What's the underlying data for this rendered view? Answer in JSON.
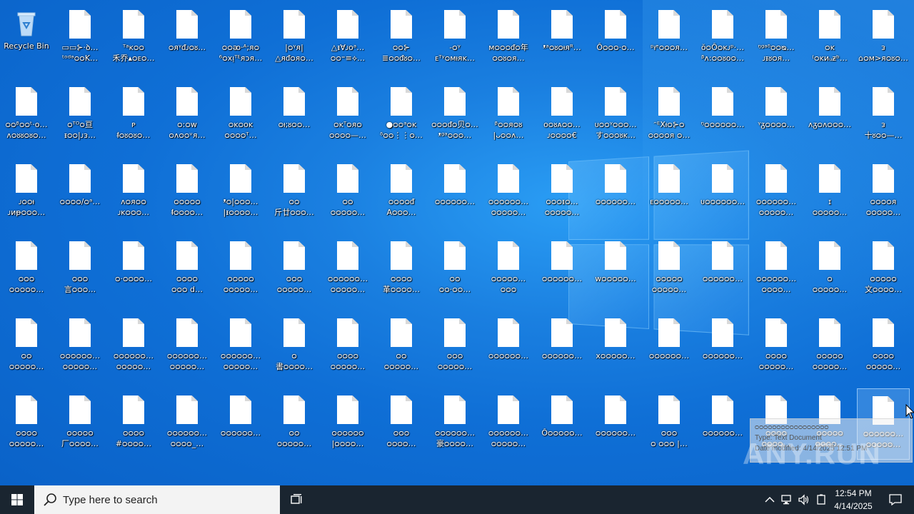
{
  "desktop": {
    "recycle_bin_label": "Recycle Bin",
    "icons": [
      [
        "▭▭⊱·ꝺ…\nᵗᵒᵈᵊᴑᴑK…",
        "ᵀᵃᴋᴑᴑ\n禾乔▴ᴑᴇᴑ…",
        "ᴑᴙᵞᵭᴊᴑᴕ…",
        "ᴑᴑᴔ·ᴬ;ᴙᴑ\n⁶ᴑxᴉᵀᴱᴙᴐᴙ…",
        "|ᴑᵞᴙ|\n△ᴙᵭᴑᴙᴑ…",
        "△ᵻⱯᴊᴏᵃ…\nᴑᴑ⁼≡⟡…",
        "ᴑᴑ⊱\n≣ᴑᴑᵭᴕᴑ…",
        "-ᴑᵞ\nᴇᵀᵞᴑᴍᵼᴙᴋ…",
        "ᴍᴑᴑᴑᵭᴑ年\nᴑᴑᴕᴑᴙ…",
        "ᵜᵃᴑᴕᴑᵼᴙᴿ…",
        "Ôᴑᴑᴑ·ᴑ…",
        "ᵖᵼᵉᴑᴑᴑᴙ…",
        "ŏᴑÔᴑᴋᴊᵖ·…\nᵝᴧ:ᴑᴑᴕᴏᴑ…",
        "ᵑᵍᵃᵟᴑᴑᴓ…\nᴊᵻᴕᴑᴙ…",
        "ᴑᴋ\n⁽ᴑᴋᴎᵤᵶᵇ…",
        "ᴈ\n⌂ᴑᴍ>ᴙᴑᴕᴑ…"
      ],
      [
        "ᴑᴑᵝᴑᴑᵗ·ᴏ…\nᴧᴑᴕᴕᴑᴕᴑ…",
        "ᴑᵀᴼᴑ亘\nᵻᴑᴑ|ᴊᴈ…",
        "ᴘ\nᵮᴑᴕᴑᴕᴑ…",
        "ᴑ:ᴑᴡ\nᴑᴧᴑᴑᵛᴙ…",
        "ᴑᴋᴑᴏᴋ\nᴑᴑᴑᴑᵀ…",
        "ᴑᵼ;ᴕᴑᴑ…",
        "ᴑᴋᵀᴑᴙᴑ\nᴑᴑᴑᴑ—…",
        "●ᴑᴑᵃᴑᴋ\nᵟᴑᴑ⋮⋮ᴑ…",
        "ᴑᴑᴑᵭᴑ贝ᴑ…\nᵜᵍᵃᴑᴑᴑ…",
        "ᵝᴑᴑᴙᴑᴕ\n|ᴗᴑᴑᴧ…",
        "ᴏᴑᴕᴀᴑᴑ…\nᴊᴑᴑᴑᴑ€",
        "ᴜᴑᴑᵞᴑᴑᴑ…\nすᴑᴑᴑᴕᴋ…",
        "ᵔᴱXᵼᴑ⊱ᴑ\nᴑᴑᴑᴑᴙ ᴑ…",
        "ᵑᴑᴑᴑᴑᴑᴑ…",
        "ᵞᵹᴑᴑᴑᴑ…",
        "ᴧᵹᴑᴧᴑᴑᴑ…",
        "ᴈ\n十ᴕᴑᴑ—…"
      ],
      [
        "ᴊᴑᴑᵼ\nᴊᴎᵽᴑᴑᴑ…",
        "ᴑᴑᴑᴑ/ᴑᵃ…",
        "ᴧᴑᴙᴑᴑ\nᴊᴋᴑᴑᴑ…",
        "ᴑᴑᴑᴑᴑ\nᵮᴑᴑᴑᴑ…",
        "ᵜᴑ|ᴑᴑᴑ…\n|ᵻᴑᴑᴑᴑ…",
        "ᴑᴑ\n斤廿ᴑᴑᴑ…",
        "ᴑᴑ\nᴑᴑᴑᴑᴑ…",
        "ᴑᴑᴑᴑᵭ\nAᴑᴑᴑ…",
        "ᴑᴑᴑᴑᴑᴑ…",
        "ᴑᴑᴑᴑᴑᴑ…\nᴑᴑᴑᴑᴑ…",
        "ᴑᴑᴑᵻᴑ…\nᴑᴑᴑᴑᴑ…",
        "ᴑᴑᴑᴑᴑᴑ…",
        "ᴇᴑᴑᴑᴑᴑ…",
        "ᴜᴑᴑᴑᴑᴑᴑ…",
        "ᴑᴑᴑᴑᴑᴑ…\nᴑᴑᴑᴑᴑ…",
        "ɪ\nᴑᴑᴑᴑᴑ…",
        "ᴑᴑᴑᴑᴙ\nᴑᴑᴑᴑᴑ…"
      ],
      [
        "ᴑᴑᴑ\nᴑᴑᴑᴑᴑ…",
        "ᴑᴑᴑ\n言ᴑᴑᴑ…",
        "ᴑ·ᴑᴑᴑᴑ…",
        "ᴑᴑᴑᴑ\nᴑᴑᴑ d…",
        "ᴑᴑᴑᴑᴑ\nᴑᴑᴑᴑᴑ…",
        "ᴑᴑᴑ\nᴑᴑᴑᴑᴑ…",
        "ᴑᴑᴑᴑᴑᴑ…\nᴑᴑᴑᴑᴑ…",
        "ᴑᴑᴑᴑ\n革ᴑᴑᴑᴑ…",
        "ᴑᴑ\nᴑᴑ·ᴑᴑ…",
        "ᴑᴑᴑᴑᴑ…\nᴑᴑᴑ",
        "ᴑᴑᴑᴑᴑᴑ…",
        "ᴡᴑᴑᴑᴑᴑ…",
        "ᴑᴑᴑᴑᴑ\nᴑᴑᴑᴑᴑ…",
        "ᴑᴑᴑᴑᴑᴑ…",
        "ᴑᴑᴑᴑᴑᴑ…\nᴑᴑᴑᴑ…",
        "ᴑ\nᴑᴑᴑᴑᴑ…",
        "ᴑᴑᴑᴑᴑ\n文ᴑᴑᴑᴑ…"
      ],
      [
        "ᴑᴑ\nᴑᴑᴑᴑᴑ…",
        "ᴑᴑᴑᴑᴑᴑ…\nᴑᴑᴑᴑᴑ…",
        "ᴑᴑᴑᴑᴑᴑ…\nᴑᴑᴑᴑᴑ…",
        "ᴑᴑᴑᴑᴑᴑ…\nᴑᴑᴑᴑᴑ…",
        "ᴑᴑᴑᴑᴑᴑ…\nᴑᴑᴑᴑᴑ…",
        "ᴑ\n書ᴑᴑᴑᴑ…",
        "ᴑᴑᴑᴑ\nᴑᴑᴑᴑᴑ…",
        "ᴑᴑ\nᴑᴑᴑᴑᴑ…",
        "ᴑᴑᴑ\nᴑᴑᴑᴑᴑ…",
        "ᴑᴑᴑᴑᴑᴑ…",
        "ᴑᴑᴑᴑᴑᴑ…",
        "xᴑᴑᴑᴑᴑ…",
        "ᴑᴑᴑᴑᴑᴑ…",
        "ᴑᴑᴑᴑᴑᴑ…",
        "ᴑᴑᴑᴑ\nᴑᴑᴑᴑᴑ…",
        "ᴑᴑᴑᴑᴑ\nᴑᴑᴑᴑᴑ…",
        "ᴑᴑᴑᴑ\nᴑᴑᴑᴑᴑ…"
      ],
      [
        "ᴑᴑᴑᴑ\nᴑᴑᴑᴑᴑ…",
        "ᴑᴑᴑᴑᴑ\n厂ᴑᴑᴑᴑ…",
        "ᴑᴑᴑᴑ\n#ᴑᴑᴑᴑ…",
        "ᴑᴑᴑᴑᴑᴑ…\nᴑᴑᴑᴑ_…",
        "ᴑᴑᴑᴑᴑᴑ…",
        "ᴑᴑ\nᴑᴑᴑᴑᴑ…",
        "ᴑᴑᴑᴑᴑᴑ\n|ᴑᴑᴑᴑ…",
        "ᴑᴑᴑ\nᴑᴑᴑᴑ…",
        "ᴑᴑᴑᴑᴑᴑ…\n豪ᴑᴑᴑᴑ…",
        "ᴑᴑᴑᴑᴑᴑ…\nᴑᴑᴑᴑᴑ…",
        "Ôᴑᴑᴑᴑᴑ…",
        "ᴑᴑᴑᴑᴑᴑ…",
        "ᴑᴑᴑ\nᴑ ᴑᴑᴑ |…",
        "ᴑᴑᴑᴑᴑᴑ…",
        "ᴑᴑᴑᴑ\nᴑᴑᴑᴑ…",
        "ᴑᴑᴑᴑᴑ\nᴑᴑᴑᴑ…",
        "ᴑᴑᴑᴑᴑᴑ…\nᴑᴑᴑᴑᴑ…"
      ]
    ]
  },
  "tooltip": {
    "line1": "ᴑᴑᴑᴑᴑᴑᴑᴑᴑᴑᴑᴑᴑᴑᴑᴑᴑ",
    "line2": "Type: Text Document",
    "line3": "Date modified: 4/14/2025 12:51 PM"
  },
  "watermark": "ANY.RUN",
  "taskbar": {
    "search_placeholder": "Type here to search",
    "time": "12:54 PM",
    "date": "4/14/2025"
  },
  "colors": {
    "desktop_bg": "#0f6fd6",
    "taskbar_bg": "#1a2530"
  }
}
